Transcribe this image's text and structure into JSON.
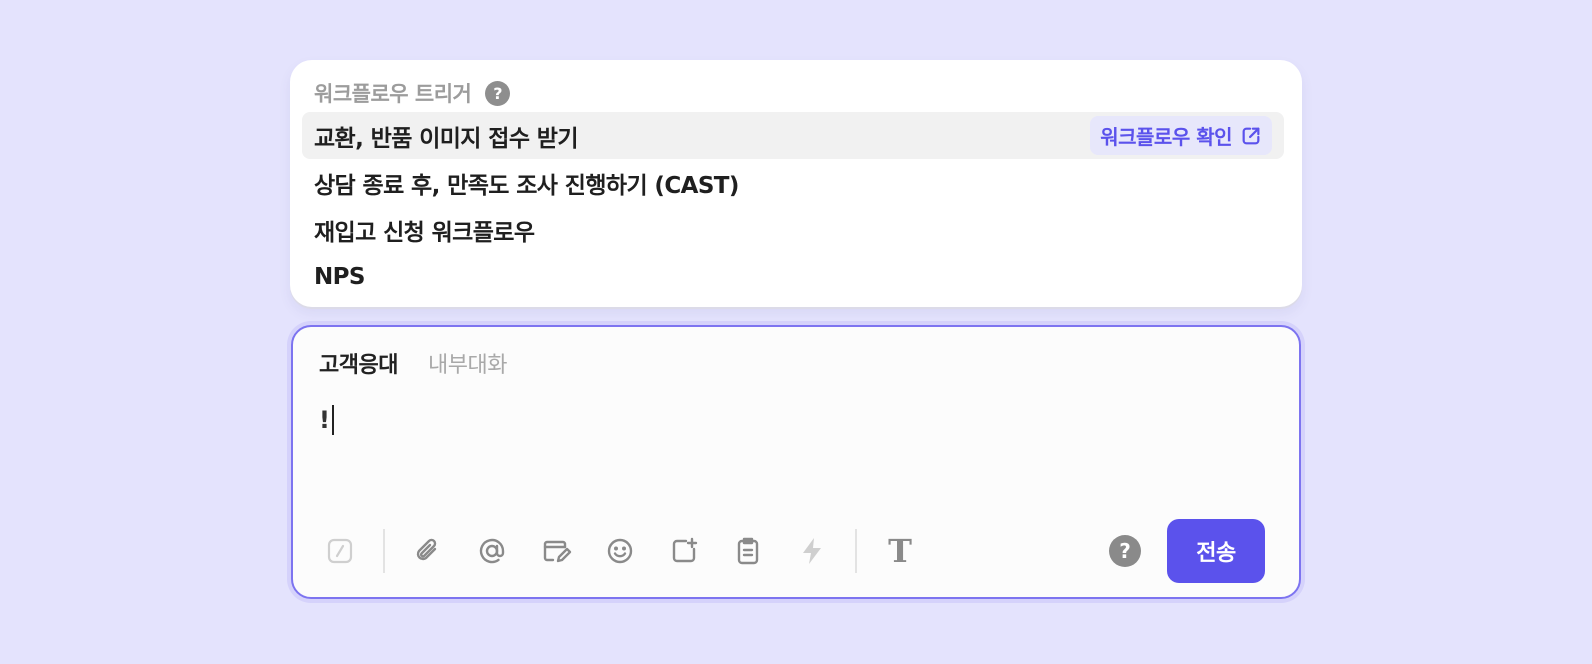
{
  "trigger_panel": {
    "title": "워크플로우 트리거",
    "help_icon": "?",
    "items": [
      {
        "label": "교환, 반품 이미지 접수 받기",
        "active": true
      },
      {
        "label": "상담 종료 후, 만족도 조사 진행하기 (CAST)",
        "active": false
      },
      {
        "label": "재입고 신청 워크플로우",
        "active": false
      },
      {
        "label": "NPS",
        "active": false
      }
    ],
    "view_link_label": "워크플로우 확인"
  },
  "composer": {
    "tabs": [
      {
        "label": "고객응대",
        "active": true
      },
      {
        "label": "내부대화",
        "active": false
      }
    ],
    "input_value": "!",
    "toolbar_icons": [
      "slash-command-icon",
      "paperclip-icon",
      "mention-icon",
      "form-edit-icon",
      "emoji-icon",
      "add-card-icon",
      "clipboard-icon",
      "lightning-icon",
      "text-format-icon"
    ],
    "help_icon": "?",
    "send_label": "전송"
  },
  "colors": {
    "background": "#e4e3fd",
    "accent": "#5b52ec",
    "active_row": "#f1f1f1"
  }
}
